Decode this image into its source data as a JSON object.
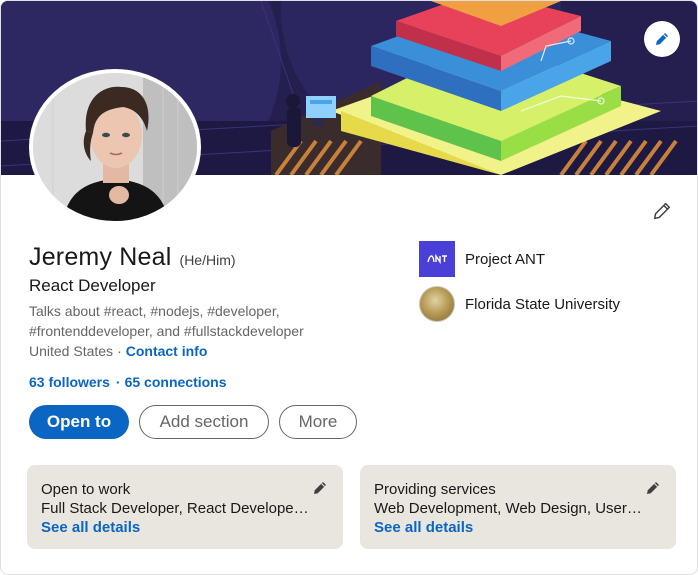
{
  "profile": {
    "name": "Jeremy Neal",
    "pronouns": "(He/Him)",
    "headline": "React Developer",
    "talks_about": "Talks about #react, #nodejs, #developer, #frontenddeveloper, and #fullstackdeveloper",
    "location": "United States",
    "contact_info": "Contact info",
    "followers": "63 followers",
    "connections": "65 connections"
  },
  "buttons": {
    "open_to": "Open to",
    "add_section": "Add section",
    "more": "More"
  },
  "orgs": [
    {
      "name": "Project ANT",
      "logo": "project-ant-logo"
    },
    {
      "name": "Florida State University",
      "logo": "fsu-seal-logo"
    }
  ],
  "cards": {
    "open_to_work": {
      "title": "Open to work",
      "description": "Full Stack Developer, React Developer, Frontend Developer",
      "link": "See all details"
    },
    "providing_services": {
      "title": "Providing services",
      "description": "Web Development, Web Design, User Experience Design",
      "link": "See all details"
    }
  },
  "icons": {
    "edit": "pencil-icon"
  },
  "colors": {
    "accent": "#0a66c2",
    "card_bg": "#e9e5df",
    "banner_bg": "#241f4f"
  }
}
